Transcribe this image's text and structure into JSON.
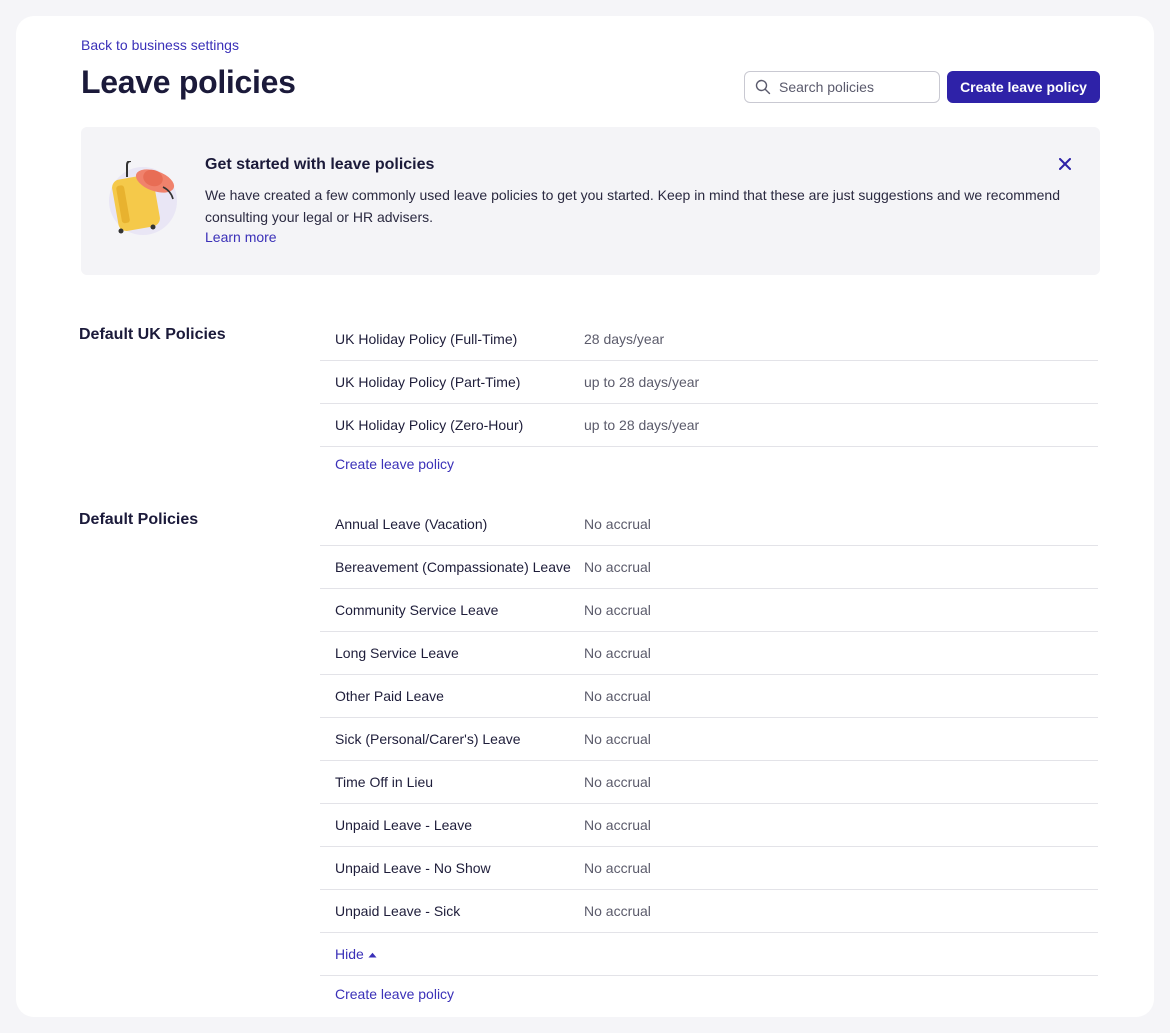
{
  "header": {
    "back_link": "Back to business settings",
    "title": "Leave policies",
    "search_placeholder": "Search policies",
    "create_button": "Create leave policy"
  },
  "banner": {
    "title": "Get started with leave policies",
    "body": "We have created a few commonly used leave policies to get you started. Keep in mind that these are just suggestions and we recommend consulting your legal or HR advisers.",
    "link": "Learn more",
    "close_icon": "close-icon",
    "illustration": "suitcase-with-hat-illustration"
  },
  "sections": [
    {
      "title": "Default UK Policies",
      "policies": [
        {
          "name": "UK Holiday Policy (Full-Time)",
          "value": "28 days/year"
        },
        {
          "name": "UK Holiday Policy (Part-Time)",
          "value": "up to 28 days/year"
        },
        {
          "name": "UK Holiday Policy (Zero-Hour)",
          "value": "up to 28 days/year"
        }
      ],
      "create_link": "Create leave policy"
    },
    {
      "title": "Default Policies",
      "policies": [
        {
          "name": "Annual Leave (Vacation)",
          "value": "No accrual"
        },
        {
          "name": "Bereavement (Compassionate) Leave",
          "value": "No accrual"
        },
        {
          "name": "Community Service Leave",
          "value": "No accrual"
        },
        {
          "name": "Long Service Leave",
          "value": "No accrual"
        },
        {
          "name": "Other Paid Leave",
          "value": "No accrual"
        },
        {
          "name": "Sick (Personal/Carer's) Leave",
          "value": "No accrual"
        },
        {
          "name": "Time Off in Lieu",
          "value": "No accrual"
        },
        {
          "name": "Unpaid Leave - Leave",
          "value": "No accrual"
        },
        {
          "name": "Unpaid Leave - No Show",
          "value": "No accrual"
        },
        {
          "name": "Unpaid Leave - Sick",
          "value": "No accrual"
        }
      ],
      "hide_link": "Hide",
      "create_link": "Create leave policy"
    }
  ],
  "colors": {
    "accent": "#2e22a8",
    "link": "#3a30b8",
    "heading": "#1b1a3a",
    "banner_bg": "#f4f4f7",
    "page_bg": "#f5f5f8"
  }
}
